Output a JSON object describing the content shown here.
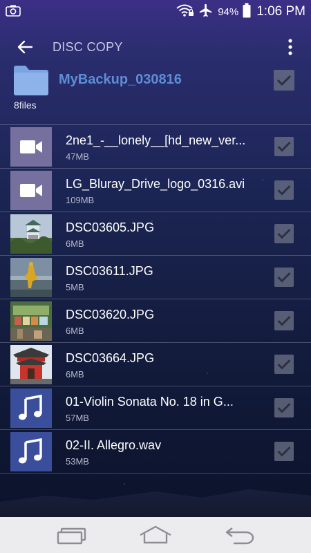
{
  "status_bar": {
    "battery_percent": "94%",
    "time": "1:06 PM",
    "icons": [
      "screenshot-icon",
      "wifi-icon",
      "airplane-icon",
      "battery-icon"
    ]
  },
  "header": {
    "title": "DISC COPY",
    "back_icon": "arrow-back-icon",
    "menu_icon": "more-vert-icon"
  },
  "folder": {
    "name": "MyBackup_030816",
    "file_count": "8files",
    "checked": true
  },
  "files": [
    {
      "name": "2ne1_-__lonely__[hd_new_ver...",
      "size": "47MB",
      "kind": "video",
      "checked": true
    },
    {
      "name": "LG_Bluray_Drive_logo_0316.avi",
      "size": "109MB",
      "kind": "video",
      "checked": true
    },
    {
      "name": "DSC03605.JPG",
      "size": "6MB",
      "kind": "photo",
      "checked": true
    },
    {
      "name": "DSC03611.JPG",
      "size": "5MB",
      "kind": "photo",
      "checked": true
    },
    {
      "name": "DSC03620.JPG",
      "size": "6MB",
      "kind": "photo",
      "checked": true
    },
    {
      "name": "DSC03664.JPG",
      "size": "6MB",
      "kind": "photo",
      "checked": true
    },
    {
      "name": "01-Violin Sonata No. 18 in G...",
      "size": "57MB",
      "kind": "audio",
      "checked": true
    },
    {
      "name": "02-II. Allegro.wav",
      "size": "53MB",
      "kind": "audio",
      "checked": true
    }
  ],
  "navbar": {
    "buttons": [
      "recent-apps-icon",
      "home-icon",
      "back-icon"
    ]
  },
  "colors": {
    "folder_name": "#5d8ed6",
    "video_thumb": "#75709e",
    "audio_thumb": "#3b4e9c",
    "checkbox": "#6f7388"
  }
}
